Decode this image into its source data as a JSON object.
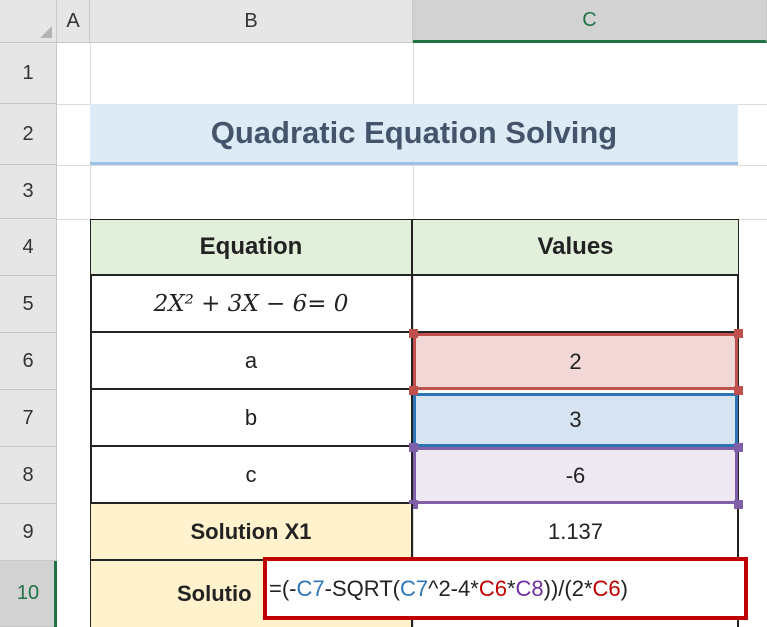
{
  "columns": {
    "a": "A",
    "b": "B",
    "c": "C"
  },
  "rows": [
    "1",
    "2",
    "3",
    "4",
    "5",
    "6",
    "7",
    "8",
    "9",
    "10"
  ],
  "title": "Quadratic Equation Solving",
  "table": {
    "header_equation": "Equation",
    "header_values": "Values",
    "equation_text": "2X² + 3X − 6= 0",
    "a_label": "a",
    "a_value": "2",
    "b_label": "b",
    "b_value": "3",
    "c_label": "c",
    "c_value": "-6",
    "sol1_label": "Solution X1",
    "sol1_value": "1.137",
    "sol2_label_partial": "Solutio"
  },
  "formula": {
    "p1": "=(-",
    "p2": "C7",
    "p3": "-SQRT(",
    "p4": "C7",
    "p5": "^2-4*",
    "p6": "C6",
    "p7": "*",
    "p8": "C8",
    "p9": "))",
    "p10": "/(2*",
    "p11": "C6",
    "p12": ")"
  },
  "colors": {
    "ref_red": "#c00000",
    "ref_blue": "#2e75b6",
    "ref_purple": "#7030a0",
    "header_fill": "#e2efda",
    "title_fill": "#ddebf7",
    "solution_fill": "#fff2cc"
  }
}
